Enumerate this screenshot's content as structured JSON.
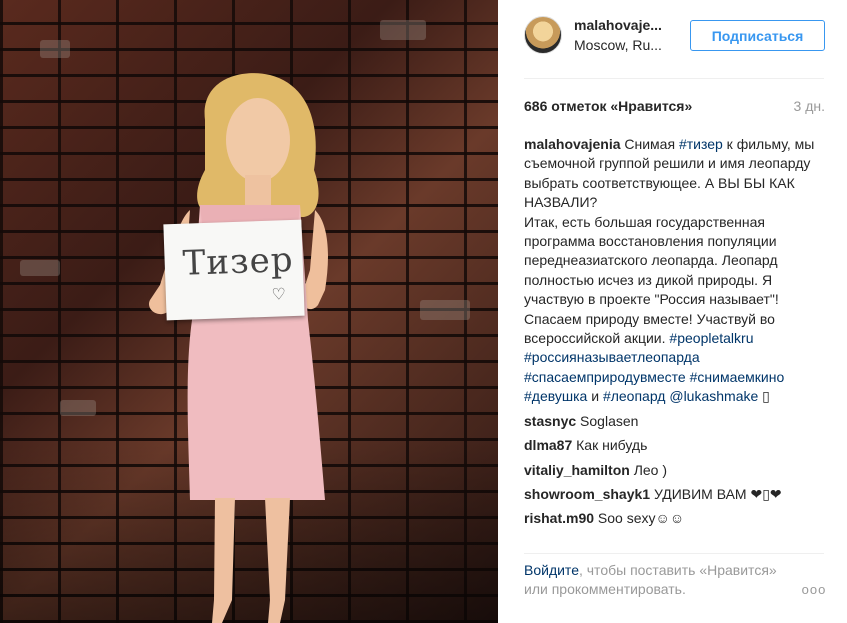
{
  "post": {
    "photo_sign_text": "Тизер",
    "photo_sign_heart": "♡"
  },
  "header": {
    "username": "malahovaje...",
    "location": "Moscow, Ru...",
    "follow_label": "Подписаться"
  },
  "stats": {
    "likes": "686 отметок «Нравится»",
    "time": "3 дн."
  },
  "caption": {
    "user": "malahovajenia",
    "part1": " Снимая ",
    "tag1": "#тизер",
    "part2": " к фильму, мы съемочной группой решили и имя леопарду выбрать соответствующее. А ВЫ БЫ КАК НАЗВАЛИ?",
    "part3": "Итак, есть большая государственная программа восстановления популяции переднеазиатского леопарда. Леопард полностью исчез из дикой природы. Я участвую в проекте \"Россия называет\"! Спасаем природу вместе! Участвуй во всероссийской акции. ",
    "tag2": "#peopletalkru",
    "tag3": "#россияназываетлеопарда",
    "tag4": "#спасаемприродувместе",
    "tag5": "#снимаемкино",
    "tag6": "#девушка",
    "and": " и ",
    "tag7": "#леопард",
    "mention": "@lukashmake",
    "trail": " ▯"
  },
  "comments": [
    {
      "user": "stasnyc",
      "text": " Soglasen"
    },
    {
      "user": "dlma87",
      "text": " Как нибудь"
    },
    {
      "user": "vitaliy_hamilton",
      "text": " Лео )"
    },
    {
      "user": "showroom_shayk1",
      "text": " УДИВИМ ВАМ ❤▯❤"
    },
    {
      "user": "rishat.m90",
      "text": " Soo sexy☺☺"
    }
  ],
  "footer": {
    "login_link": "Войдите",
    "login_text": ", чтобы поставить «Нравится» или прокомментировать.",
    "more_icon": "ooo"
  }
}
